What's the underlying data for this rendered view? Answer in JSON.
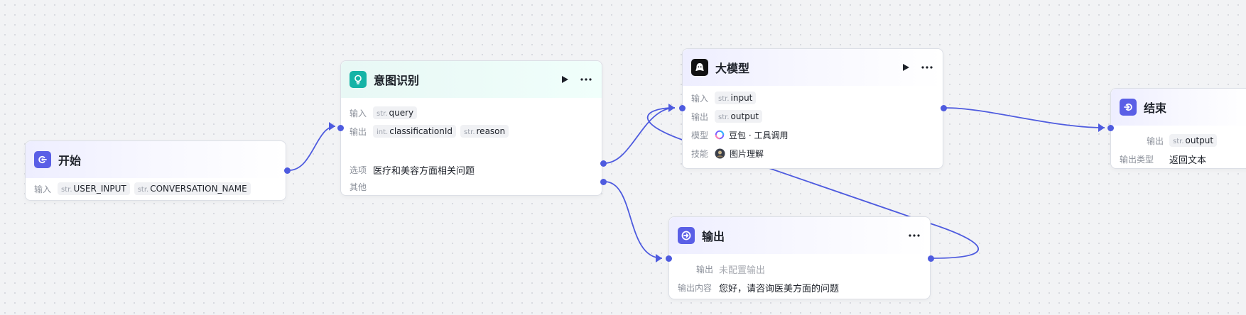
{
  "accent_color": "#4e5bdf",
  "nodes": {
    "start": {
      "title": "开始",
      "icon": "start-icon",
      "input_label": "输入",
      "inputs": [
        {
          "type": "str.",
          "name": "USER_INPUT"
        },
        {
          "type": "str.",
          "name": "CONVERSATION_NAME"
        }
      ]
    },
    "intent": {
      "title": "意图识别",
      "icon": "lightbulb-icon",
      "input_label": "输入",
      "inputs": [
        {
          "type": "str.",
          "name": "query"
        }
      ],
      "output_label": "输出",
      "outputs": [
        {
          "type": "int.",
          "name": "classificationId"
        },
        {
          "type": "str.",
          "name": "reason"
        }
      ],
      "option_label": "选项",
      "option_value": "医疗和美容方面相关问题",
      "other_label": "其他"
    },
    "llm": {
      "title": "大模型",
      "icon": "model-icon",
      "input_label": "输入",
      "inputs": [
        {
          "type": "str.",
          "name": "input"
        }
      ],
      "output_label": "输出",
      "outputs": [
        {
          "type": "str.",
          "name": "output"
        }
      ],
      "model_label": "模型",
      "model_value": "豆包 · 工具调用",
      "skill_label": "技能",
      "skill_value": "图片理解"
    },
    "end": {
      "title": "结束",
      "icon": "end-icon",
      "output_label": "输出",
      "outputs": [
        {
          "type": "str.",
          "name": "output"
        }
      ],
      "output_type_label": "输出类型",
      "output_type_value": "返回文本"
    },
    "output": {
      "title": "输出",
      "icon": "output-icon",
      "output_label": "输出",
      "output_placeholder": "未配置输出",
      "content_label": "输出内容",
      "content_value": "您好，请咨询医美方面的问题"
    }
  }
}
